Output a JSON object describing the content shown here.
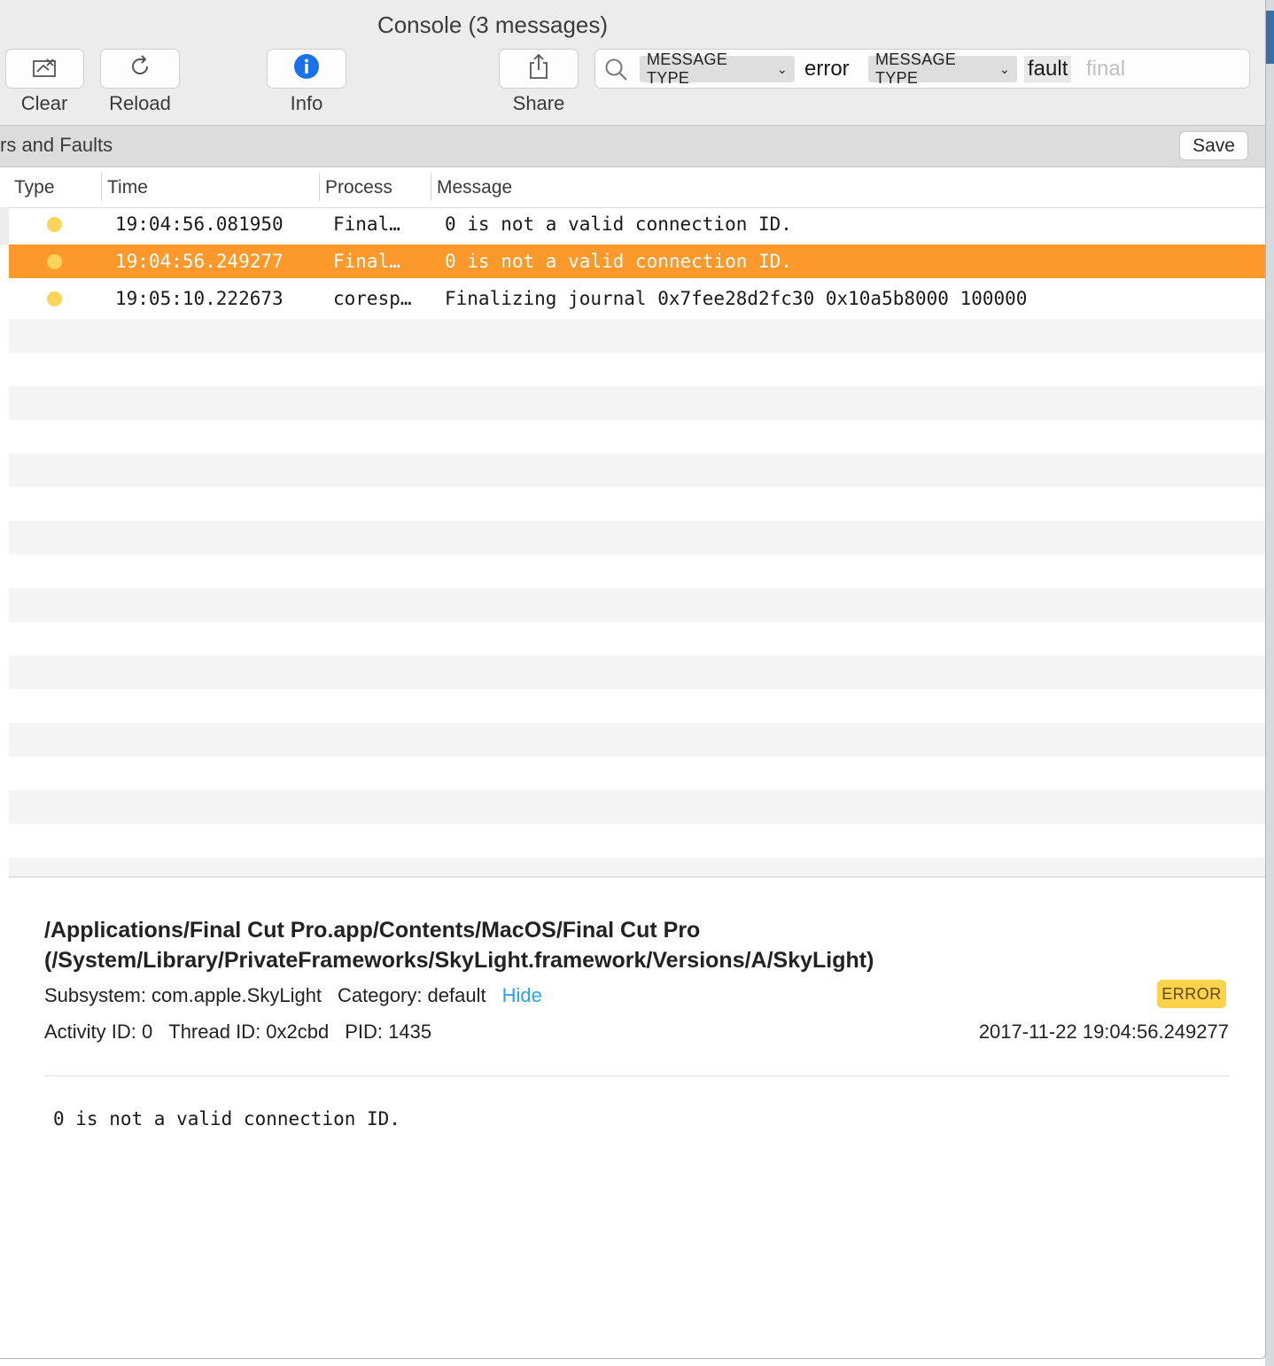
{
  "window": {
    "title": "Console (3 messages)"
  },
  "toolbar": {
    "clear_label": "Clear",
    "reload_label": "Reload",
    "info_label": "Info",
    "share_label": "Share"
  },
  "search": {
    "tokens": [
      {
        "key": "MESSAGE TYPE",
        "value": "error"
      },
      {
        "key": "MESSAGE TYPE",
        "value": "fault"
      }
    ],
    "typed_text": "final"
  },
  "filter_bar": {
    "name": "rs and Faults",
    "save_label": "Save"
  },
  "table": {
    "columns": [
      "Type",
      "Time",
      "Process",
      "Message"
    ],
    "rows": [
      {
        "time": "19:04:56.081950",
        "process": "Final…",
        "message": "0 is not a valid connection ID.",
        "selected": false
      },
      {
        "time": "19:04:56.249277",
        "process": "Final…",
        "message": "0 is not a valid connection ID.",
        "selected": true
      },
      {
        "time": "19:05:10.222673",
        "process": "coresp…",
        "message": "Finalizing journal 0x7fee28d2fc30 0x10a5b8000 100000",
        "selected": false
      }
    ],
    "type_dot_color": "#fdd45a",
    "selection_color": "#fd982b"
  },
  "detail": {
    "path": "/Applications/Final Cut Pro.app/Contents/MacOS/Final Cut Pro (/System/Library/PrivateFrameworks/SkyLight.framework/Versions/A/SkyLight)",
    "subsystem": "Subsystem: com.apple.SkyLight",
    "category": "Category: default",
    "hide_label": "Hide",
    "badge": "ERROR",
    "activity_id": "Activity ID: 0",
    "thread_id": "Thread ID: 0x2cbd",
    "pid": "PID: 1435",
    "timestamp": "2017-11-22 19:04:56.249277",
    "message": "0 is not a valid connection ID."
  }
}
